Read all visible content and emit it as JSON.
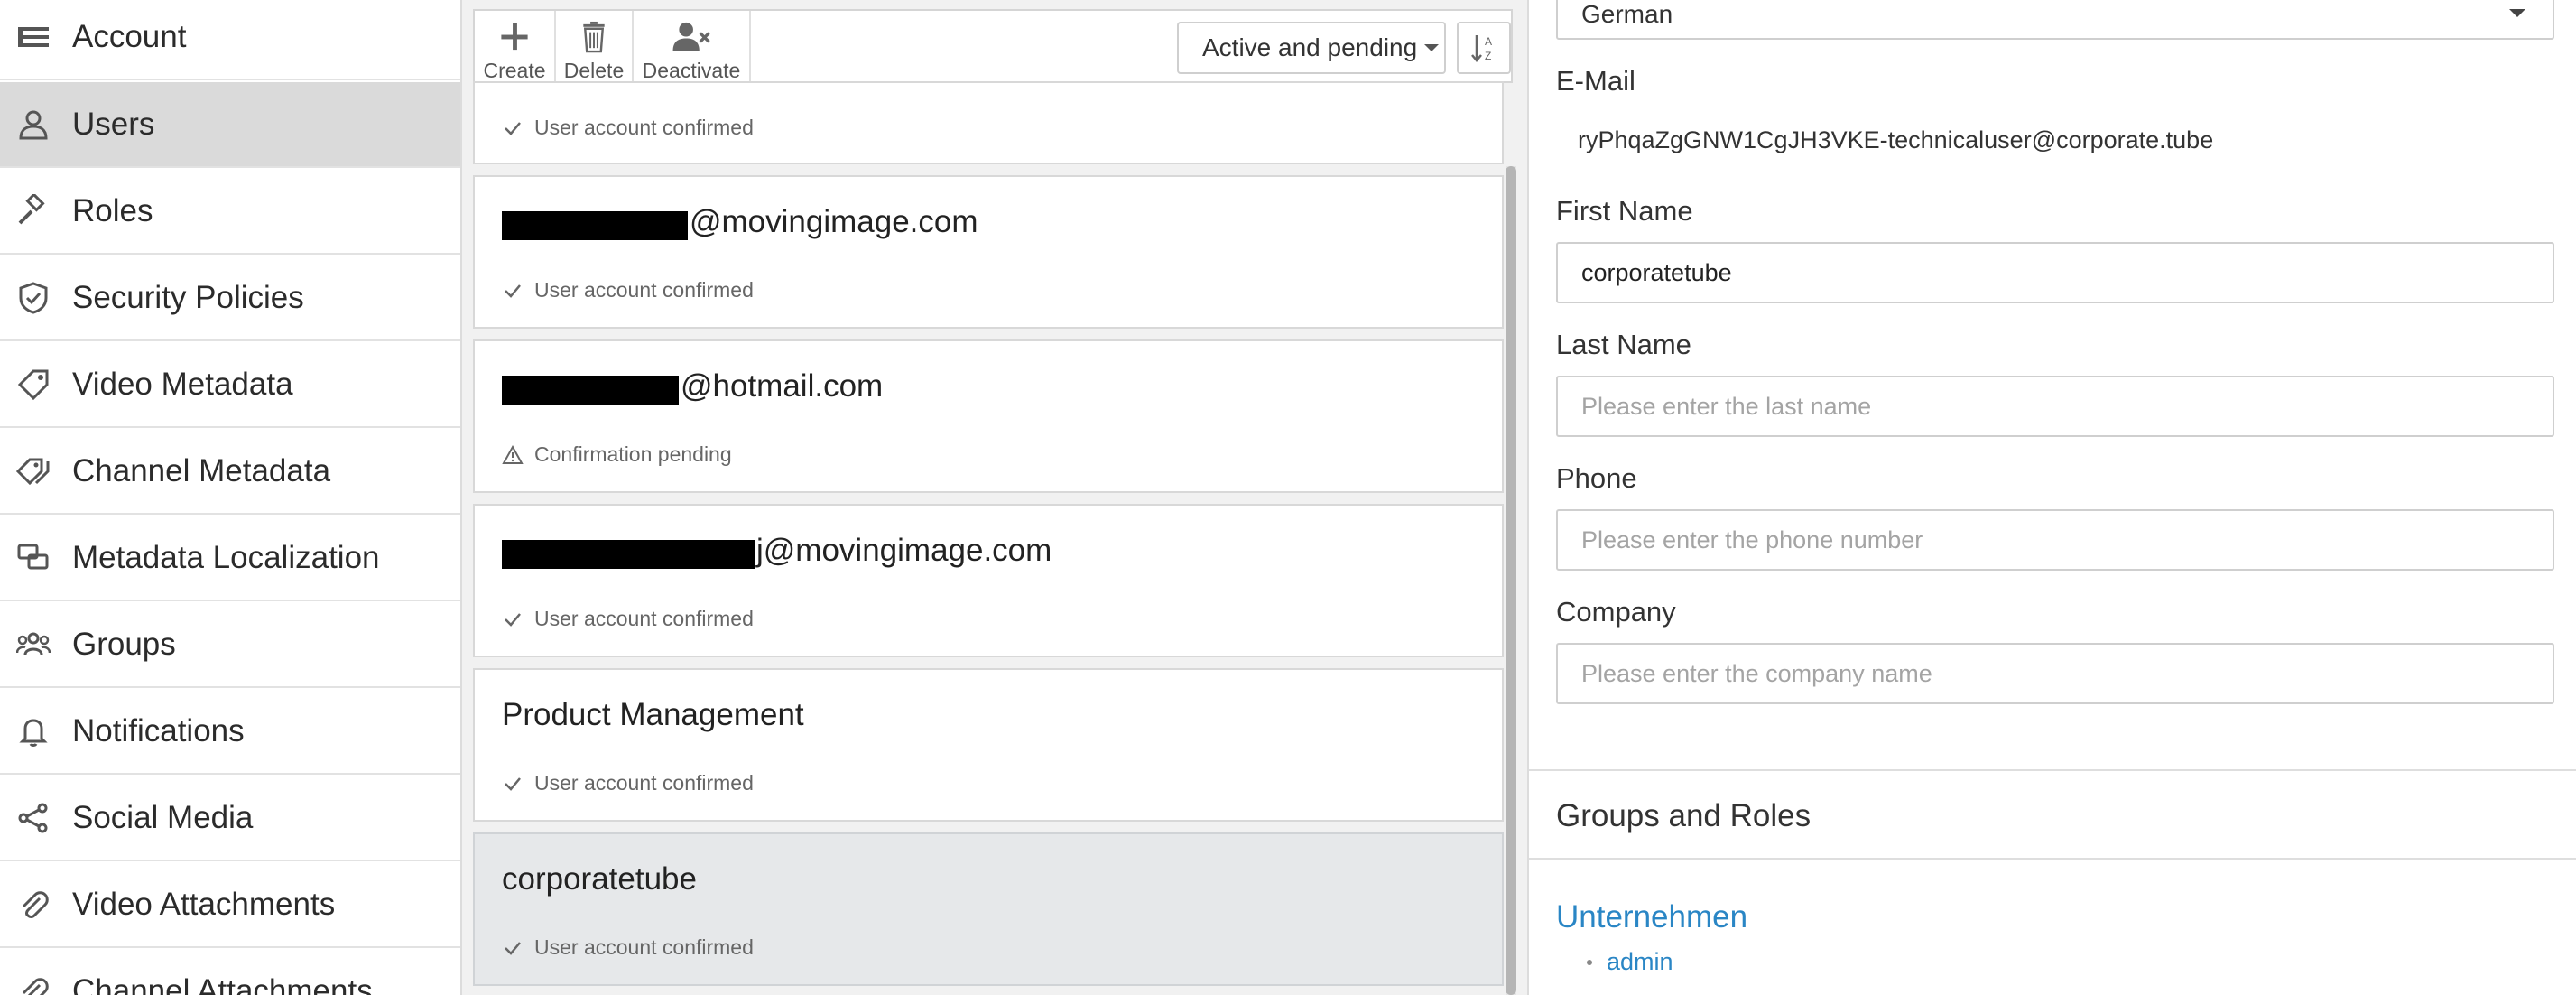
{
  "sidebar": {
    "items": [
      {
        "label": "Account",
        "icon": "account-list-icon",
        "active": false
      },
      {
        "label": "Users",
        "icon": "user-icon",
        "active": true
      },
      {
        "label": "Roles",
        "icon": "gavel-icon",
        "active": false
      },
      {
        "label": "Security Policies",
        "icon": "shield-check-icon",
        "active": false
      },
      {
        "label": "Video Metadata",
        "icon": "tag-icon",
        "active": false
      },
      {
        "label": "Channel Metadata",
        "icon": "tags-icon",
        "active": false
      },
      {
        "label": "Metadata Localization",
        "icon": "comments-icon",
        "active": false
      },
      {
        "label": "Groups",
        "icon": "group-icon",
        "active": false
      },
      {
        "label": "Notifications",
        "icon": "bell-icon",
        "active": false
      },
      {
        "label": "Social Media",
        "icon": "share-icon",
        "active": false
      },
      {
        "label": "Video Attachments",
        "icon": "paperclip-icon",
        "active": false
      },
      {
        "label": "Channel Attachments",
        "icon": "paperclip-icon",
        "active": false
      }
    ]
  },
  "toolbar": {
    "create_label": "Create",
    "delete_label": "Delete",
    "deactivate_label": "Deactivate",
    "filter_value": "Active and pending",
    "sort_icon": "sort-alpha-down-icon"
  },
  "user_list": {
    "items": [
      {
        "name": "",
        "status": "User account confirmed",
        "status_icon": "check-icon",
        "selected": false
      },
      {
        "name": "@movingimage.com",
        "status": "User account confirmed",
        "status_icon": "check-icon",
        "selected": false
      },
      {
        "name": "@hotmail.com",
        "status": "Confirmation pending",
        "status_icon": "warning-icon",
        "selected": false
      },
      {
        "name": "j@movingimage.com",
        "status": "User account confirmed",
        "status_icon": "check-icon",
        "selected": false
      },
      {
        "name": "Product Management",
        "status": "User account confirmed",
        "status_icon": "check-icon",
        "selected": false
      },
      {
        "name": "corporatetube",
        "status": "User account confirmed",
        "status_icon": "check-icon",
        "selected": true
      }
    ]
  },
  "detail": {
    "language_value": "German",
    "email_label": "E-Mail",
    "email_value": "ryPhqaZgGNW1CgJH3VKE-technicaluser@corporate.tube",
    "first_name_label": "First Name",
    "first_name_value": "corporatetube",
    "last_name_label": "Last Name",
    "last_name_placeholder": "Please enter the last name",
    "phone_label": "Phone",
    "phone_placeholder": "Please enter the phone number",
    "company_label": "Company",
    "company_placeholder": "Please enter the company name",
    "groups_title": "Groups and Roles",
    "group_name": "Unternehmen",
    "role_name": "admin"
  },
  "colors": {
    "link": "#2a86c5",
    "active_nav": "#dadada",
    "selected_card": "#e6e8ea"
  }
}
